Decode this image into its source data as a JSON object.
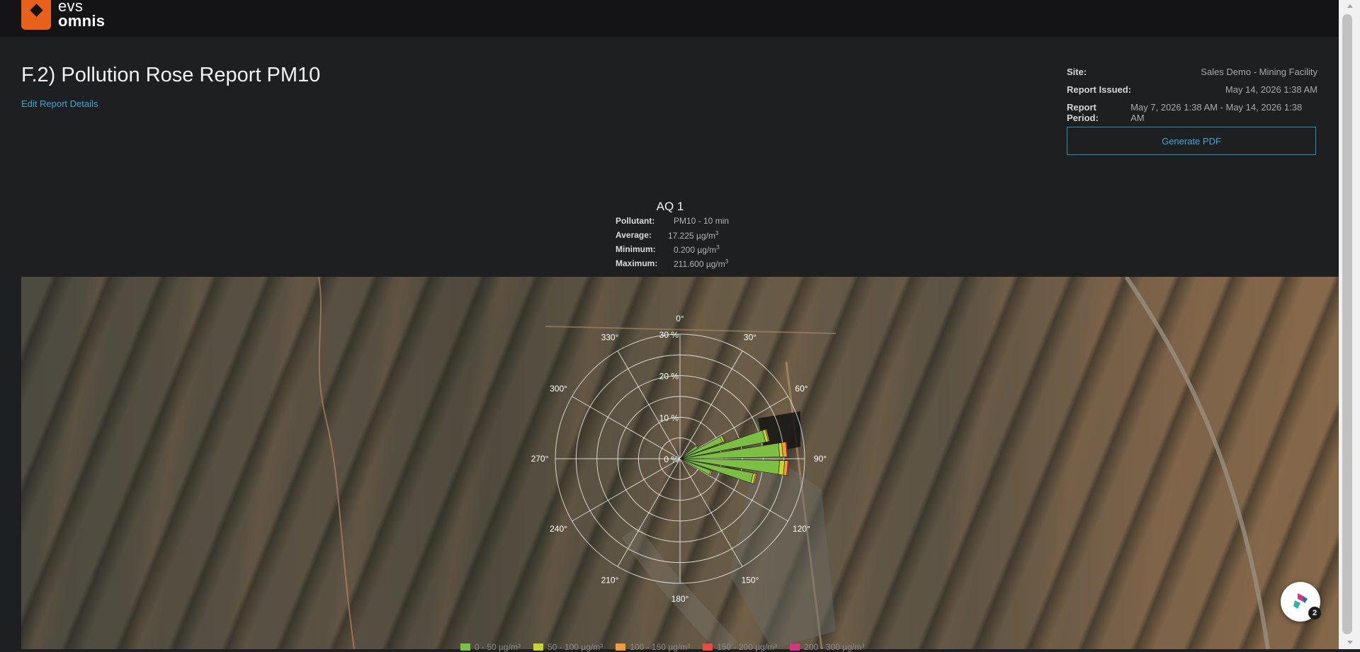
{
  "brand": {
    "line1": "evs",
    "line2": "omnis",
    "accent": "#e8611a"
  },
  "report": {
    "title": "F.2) Pollution Rose Report PM10",
    "edit_link": "Edit Report Details"
  },
  "meta": {
    "site_label": "Site:",
    "site_value": "Sales Demo - Mining Facility",
    "issued_label": "Report Issued:",
    "issued_value": "May 14, 2026 1:38 AM",
    "period_label": "Report Period:",
    "period_value": "May 7, 2026 1:38 AM - May 14, 2026 1:38 AM"
  },
  "actions": {
    "generate_pdf": "Generate PDF"
  },
  "station": {
    "name": "AQ 1",
    "pollutant_label": "Pollutant:",
    "pollutant_value": "PM10 - 10 min",
    "average_label": "Average:",
    "average_value": "17.225 µg/m",
    "minimum_label": "Minimum:",
    "minimum_value": "0.200 µg/m",
    "maximum_label": "Maximum:",
    "maximum_value": "211.600 µg/m",
    "unit_exponent": "3"
  },
  "chart_data": {
    "type": "polar-bar",
    "radial_ticks": [
      "0 %",
      "10 %",
      "20 %",
      "30 %"
    ],
    "radial_max": 30,
    "angle_labels": [
      "0°",
      "30°",
      "60°",
      "90°",
      "120°",
      "150°",
      "180°",
      "210°",
      "240°",
      "270°",
      "300°",
      "330°"
    ],
    "bins": [
      {
        "name": "0 - 50 µg/m³",
        "color": "#7bc043"
      },
      {
        "name": "50 - 100 µg/m³",
        "color": "#c8d62b"
      },
      {
        "name": "100 - 150 µg/m³",
        "color": "#f39c35"
      },
      {
        "name": "150 - 200 µg/m³",
        "color": "#e74c3c"
      },
      {
        "name": "200 - 300 µg/m³",
        "color": "#d63384"
      }
    ],
    "sectors": [
      {
        "direction": 65,
        "values": [
          11,
          0.5,
          0.2,
          0,
          0
        ]
      },
      {
        "direction": 75,
        "values": [
          21,
          0.7,
          0.3,
          0.1,
          0
        ]
      },
      {
        "direction": 85,
        "values": [
          24,
          0.8,
          1.0,
          0.2,
          0
        ]
      },
      {
        "direction": 95,
        "values": [
          24,
          1.2,
          0.8,
          0.3,
          0
        ]
      },
      {
        "direction": 105,
        "values": [
          18,
          0.6,
          0.3,
          0,
          0
        ]
      },
      {
        "direction": 115,
        "values": [
          8,
          0.3,
          0,
          0,
          0
        ]
      },
      {
        "direction": 55,
        "values": [
          5,
          0.2,
          0,
          0,
          0
        ]
      }
    ]
  },
  "legend": [
    "0 - 50 µg/m³",
    "50 - 100 µg/m³",
    "100 - 150 µg/m³",
    "150 - 200 µg/m³",
    "200 - 300 µg/m³"
  ],
  "chat": {
    "badge": "2"
  }
}
